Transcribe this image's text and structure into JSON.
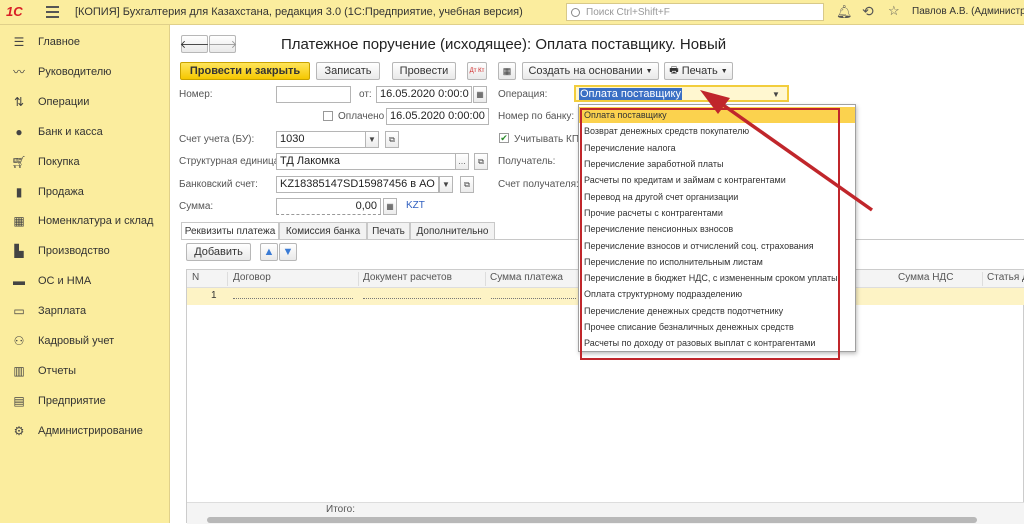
{
  "topbar": {
    "logo": "1С",
    "menu_icon": "hamburger-icon",
    "title": "[КОПИЯ] Бухгалтерия для Казахстана, редакция 3.0  (1С:Предприятие, учебная версия)",
    "search_placeholder": "Поиск Ctrl+Shift+F",
    "user": "Павлов А.В. (Администр"
  },
  "sidebar": {
    "items": [
      {
        "label": "Главное",
        "icon": "menu-lines-icon"
      },
      {
        "label": "Руководителю",
        "icon": "chart-line-icon"
      },
      {
        "label": "Операции",
        "icon": "dt-kt-icon"
      },
      {
        "label": "Банк и касса",
        "icon": "coin-icon"
      },
      {
        "label": "Покупка",
        "icon": "cart-icon"
      },
      {
        "label": "Продажа",
        "icon": "bag-icon"
      },
      {
        "label": "Номенклатура и склад",
        "icon": "grid-icon"
      },
      {
        "label": "Производство",
        "icon": "factory-icon"
      },
      {
        "label": "ОС и НМА",
        "icon": "truck-icon"
      },
      {
        "label": "Зарплата",
        "icon": "money-icon"
      },
      {
        "label": "Кадровый учет",
        "icon": "people-icon"
      },
      {
        "label": "Отчеты",
        "icon": "bar-chart-icon"
      },
      {
        "label": "Предприятие",
        "icon": "building-icon"
      },
      {
        "label": "Администрирование",
        "icon": "gear-icon"
      }
    ]
  },
  "form": {
    "back": "🡐",
    "forward": "🡒",
    "title": "Платежное поручение (исходящее): Оплата поставщику. Новый",
    "toolbar": {
      "post_close": "Провести и закрыть",
      "save": "Записать",
      "post": "Провести",
      "dt_kt": "Дт Кт",
      "create_based": "Создать на основании",
      "print": "Печать"
    },
    "fields": {
      "number_label": "Номер:",
      "number_value": "",
      "from_label": "от:",
      "date_value": "16.05.2020  0:00:0",
      "operation_label": "Операция:",
      "operation_value": "Оплата поставщику",
      "paid_label": "Оплачено",
      "paid_date": "16.05.2020  0:00:00",
      "bank_number_label": "Номер по банку:",
      "account_label": "Счет учета (БУ):",
      "account_value": "1030",
      "consider_label": "Учитывать КП",
      "unit_label": "Структурная единица:",
      "unit_value": "ТД Лакомка",
      "recipient_label": "Получатель:",
      "bank_account_label": "Банковский счет:",
      "bank_account_value": "KZ18385147SD15987456 в АО",
      "recipient_account_label": "Счет получателя:",
      "sum_label": "Сумма:",
      "sum_value": "0,00",
      "currency": "KZT"
    },
    "tabs": [
      "Реквизиты платежа",
      "Комиссия банка",
      "Печать",
      "Дополнительно"
    ],
    "add_button": "Добавить",
    "table": {
      "columns": [
        "N",
        "Договор",
        "Документ расчетов",
        "Сумма платежа",
        "Сумма НДС",
        "Статья Д"
      ],
      "rows": [
        {
          "n": "1"
        }
      ],
      "total_label": "Итого:"
    }
  },
  "dropdown": {
    "items": [
      "Оплата поставщику",
      "Возврат денежных средств покупателю",
      "Перечисление налога",
      "Перечисление заработной платы",
      "Расчеты по кредитам и займам с контрагентами",
      "Перевод на другой счет организации",
      "Прочие расчеты с контрагентами",
      "Перечисление пенсионных взносов",
      "Перечисление взносов и отчислений соц. страхования",
      "Перечисление по исполнительным листам",
      "Перечисление в бюджет НДС, с измененным сроком уплаты",
      "Оплата структурному подразделению",
      "Перечисление денежных средств подотчетнику",
      "Прочее списание безналичных денежных средств",
      "Расчеты по доходу от разовых выплат с контрагентами"
    ],
    "selected_index": 0
  },
  "colors": {
    "accent": "#fbed9e",
    "primary_button": "#f5c700",
    "highlight": "#fbd24e",
    "annotation": "#c0262b"
  }
}
